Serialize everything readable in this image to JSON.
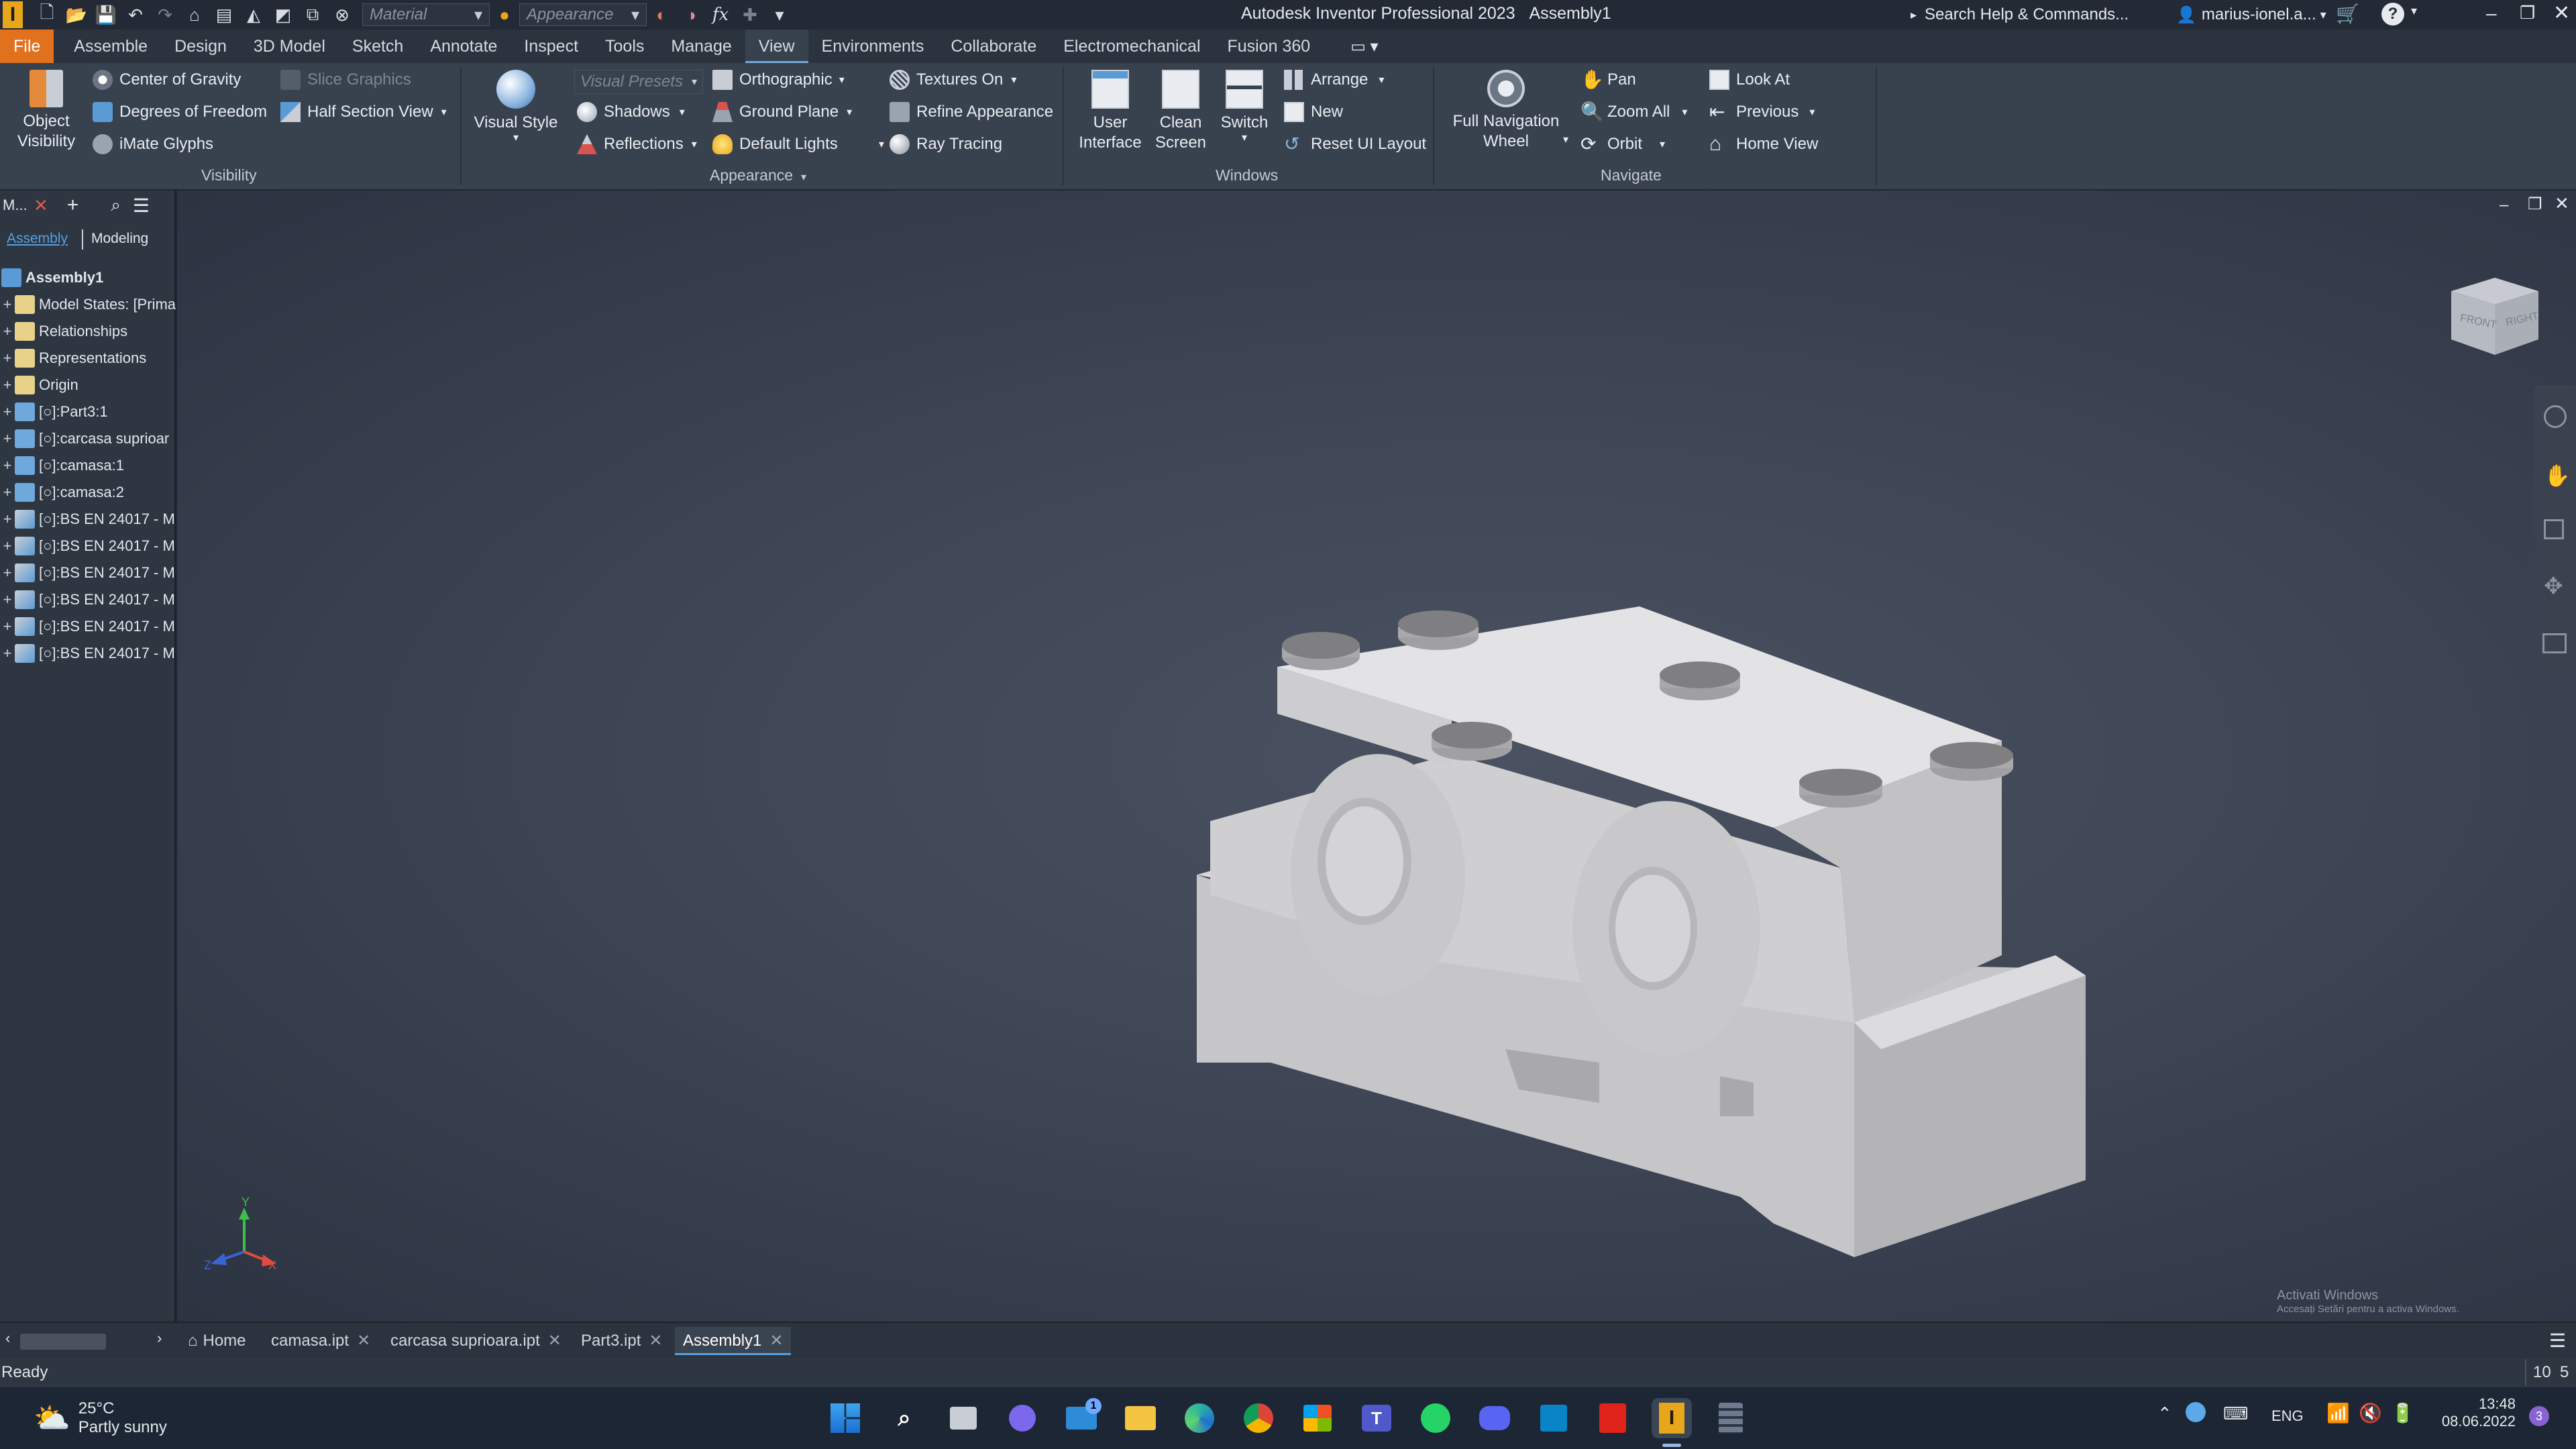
{
  "title_bar": {
    "app_title": "Autodesk Inventor Professional 2023",
    "doc_title": "Assembly1",
    "material_placeholder": "Material",
    "appearance_placeholder": "Appearance",
    "search_text": "Search Help & Commands...",
    "user": "marius-ionel.a..."
  },
  "ribbon_tabs": [
    "File",
    "Assemble",
    "Design",
    "3D Model",
    "Sketch",
    "Annotate",
    "Inspect",
    "Tools",
    "Manage",
    "View",
    "Environments",
    "Collaborate",
    "Electromechanical",
    "Fusion 360"
  ],
  "active_tab": "View",
  "ribbon": {
    "visibility": {
      "object_visibility": "Object\nVisibility",
      "center_of_gravity": "Center of Gravity",
      "degrees_of_freedom": "Degrees of Freedom",
      "imate_glyphs": "iMate Glyphs",
      "slice_graphics": "Slice Graphics",
      "half_section_view": "Half Section View",
      "label": "Visibility"
    },
    "appearance": {
      "visual_style": "Visual Style",
      "visual_presets": "Visual Presets",
      "shadows": "Shadows",
      "reflections": "Reflections",
      "orthographic": "Orthographic",
      "ground_plane": "Ground Plane",
      "default_lights": "Default Lights",
      "textures_on": "Textures On",
      "refine_appearance": "Refine Appearance",
      "ray_tracing": "Ray Tracing",
      "label": "Appearance"
    },
    "windows": {
      "user_interface": "User\nInterface",
      "clean_screen": "Clean\nScreen",
      "switch": "Switch",
      "arrange": "Arrange",
      "new": "New",
      "reset_ui_layout": "Reset UI Layout",
      "label": "Windows"
    },
    "navigate": {
      "full_navigation_wheel": "Full Navigation\nWheel",
      "pan": "Pan",
      "zoom_all": "Zoom All",
      "orbit": "Orbit",
      "look_at": "Look At",
      "previous": "Previous",
      "home_view": "Home View",
      "label": "Navigate"
    }
  },
  "browser": {
    "header_label": "M...",
    "tab_assembly": "Assembly",
    "tab_modeling": "Modeling",
    "items": [
      {
        "label": "Assembly1"
      },
      {
        "label": "Model States: [Prima"
      },
      {
        "label": "Relationships"
      },
      {
        "label": "Representations"
      },
      {
        "label": "Origin"
      },
      {
        "label": "[○]:Part3:1"
      },
      {
        "label": "[○]:carcasa suprioar"
      },
      {
        "label": "[○]:camasa:1"
      },
      {
        "label": "[○]:camasa:2"
      },
      {
        "label": "[○]:BS EN 24017 - M"
      },
      {
        "label": "[○]:BS EN 24017 - M"
      },
      {
        "label": "[○]:BS EN 24017 - M"
      },
      {
        "label": "[○]:BS EN 24017 - M"
      },
      {
        "label": "[○]:BS EN 24017 - M"
      },
      {
        "label": "[○]:BS EN 24017 - M"
      }
    ]
  },
  "viewcube": {
    "front": "FRONT",
    "right": "RIGHT"
  },
  "triad": {
    "y": "Y",
    "x": "X",
    "z": "Z"
  },
  "watermark": {
    "line1": "Activati Windows",
    "line2": "Accesați Setări pentru a activa Windows."
  },
  "doc_tabs": {
    "home": "Home",
    "tabs": [
      "camasa.ipt",
      "carcasa suprioara.ipt",
      "Part3.ipt",
      "Assembly1"
    ],
    "active": "Assembly1"
  },
  "status": {
    "text": "Ready",
    "counts": "10",
    "count2": "5"
  },
  "taskbar": {
    "weather_temp": "25°C",
    "weather_desc": "Partly sunny",
    "lang": "ENG",
    "time": "13:48",
    "date": "08.06.2022",
    "notif_count": "3",
    "mail_badge": "1"
  },
  "colors": {
    "file_tab": "#e2711d",
    "accent": "#56a0e0",
    "model": "#d4d4d6"
  }
}
